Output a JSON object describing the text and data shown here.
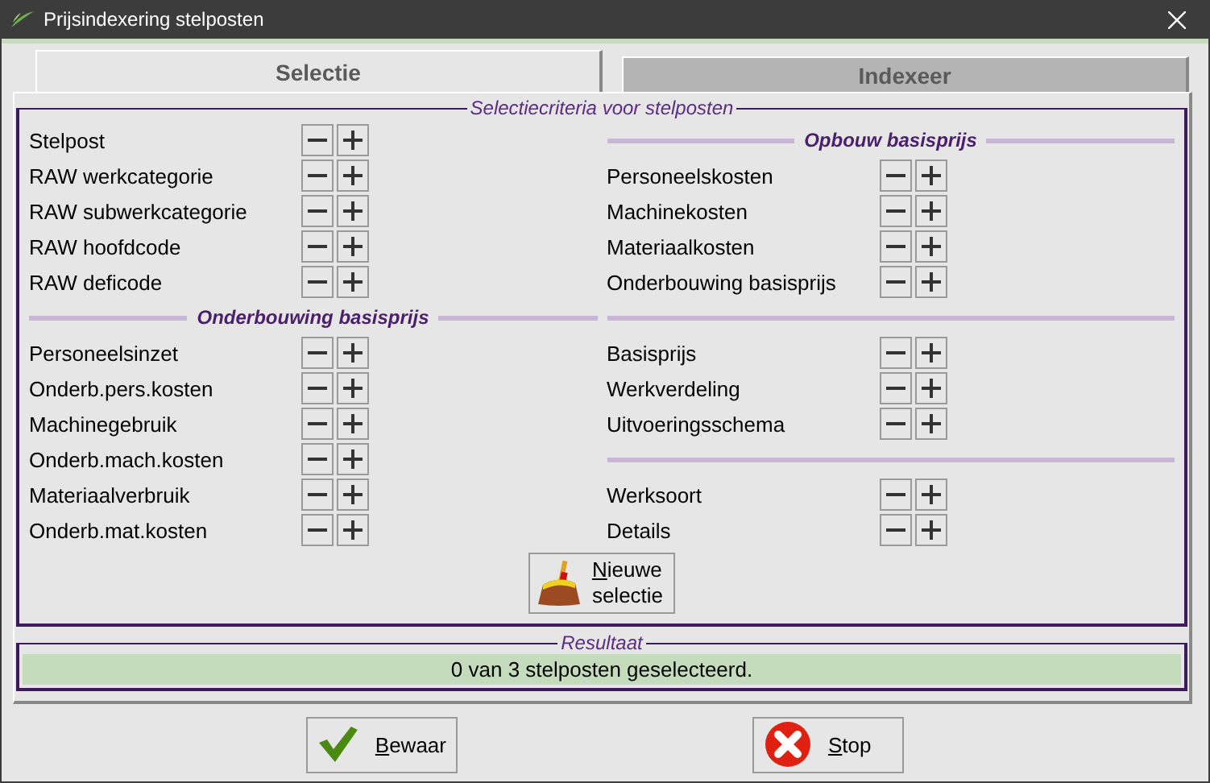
{
  "window": {
    "title": "Prijsindexering stelposten"
  },
  "tabs": [
    {
      "label": "Selectie",
      "selected": true
    },
    {
      "label": "Indexeer",
      "selected": false
    }
  ],
  "criteria": {
    "title": "Selectiecriteria voor stelposten",
    "columns": [
      [
        {
          "kind": "row",
          "label": "Stelpost"
        },
        {
          "kind": "row",
          "label": "RAW werkcategorie"
        },
        {
          "kind": "row",
          "label": "RAW subwerkcategorie"
        },
        {
          "kind": "row",
          "label": "RAW hoofdcode"
        },
        {
          "kind": "row",
          "label": "RAW deficode"
        },
        {
          "kind": "header",
          "label": "Onderbouwing basisprijs"
        },
        {
          "kind": "row",
          "label": "Personeelsinzet"
        },
        {
          "kind": "row",
          "label": "Onderb.pers.kosten"
        },
        {
          "kind": "row",
          "label": "Machinegebruik"
        },
        {
          "kind": "row",
          "label": "Onderb.mach.kosten"
        },
        {
          "kind": "row",
          "label": "Materiaalverbruik"
        },
        {
          "kind": "row",
          "label": "Onderb.mat.kosten"
        }
      ],
      [
        {
          "kind": "header",
          "label": "Opbouw basisprijs"
        },
        {
          "kind": "row",
          "label": "Personeelskosten"
        },
        {
          "kind": "row",
          "label": "Machinekosten"
        },
        {
          "kind": "row",
          "label": "Materiaalkosten"
        },
        {
          "kind": "row",
          "label": "Onderbouwing basisprijs"
        },
        {
          "kind": "divider"
        },
        {
          "kind": "row",
          "label": "Basisprijs"
        },
        {
          "kind": "row",
          "label": "Werkverdeling"
        },
        {
          "kind": "row",
          "label": "Uitvoeringsschema"
        },
        {
          "kind": "divider"
        },
        {
          "kind": "row",
          "label": "Werksoort"
        },
        {
          "kind": "row",
          "label": "Details"
        }
      ]
    ],
    "new_selection": {
      "lines": [
        "Nieuwe",
        "selectie"
      ],
      "underline_first": true
    }
  },
  "result": {
    "title": "Resultaat",
    "text": "0 van 3 stelposten geselecteerd."
  },
  "buttons": [
    {
      "kind": "save",
      "label": "Bewaar",
      "underline_first": true
    },
    {
      "kind": "stop",
      "label": "Stop",
      "underline_first": true
    }
  ]
}
